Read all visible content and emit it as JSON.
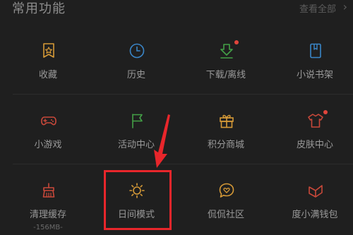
{
  "header": {
    "title": "常用功能",
    "view_all": "查看全部"
  },
  "rows": [
    [
      {
        "label": "收藏",
        "icon": "bookmark-star-icon",
        "color": "#d69a37"
      },
      {
        "label": "历史",
        "icon": "clock-icon",
        "color": "#3a86c8"
      },
      {
        "label": "下载/离线",
        "icon": "download-icon",
        "color": "#43a047",
        "badge": true
      },
      {
        "label": "小说书架",
        "icon": "bookshelf-icon",
        "color": "#3a86c8"
      }
    ],
    [
      {
        "label": "小游戏",
        "icon": "gamepad-icon",
        "color": "#c8483a"
      },
      {
        "label": "活动中心",
        "icon": "flag-icon",
        "color": "#43a047"
      },
      {
        "label": "积分商城",
        "icon": "gift-icon",
        "color": "#d69a37"
      },
      {
        "label": "皮肤中心",
        "icon": "shirt-icon",
        "color": "#c8483a",
        "badge": true
      }
    ],
    [
      {
        "label": "清理缓存",
        "icon": "broom-icon",
        "color": "#c8483a",
        "sub": "-156MB-"
      },
      {
        "label": "日间模式",
        "icon": "sun-icon",
        "color": "#d69a37"
      },
      {
        "label": "侃侃社区",
        "icon": "chat-heart-icon",
        "color": "#d69a37"
      },
      {
        "label": "度小满钱包",
        "icon": "wallet-icon",
        "color": "#c8483a"
      }
    ]
  ],
  "colors": {
    "highlight": "#e8262b",
    "badge": "#e2453c"
  }
}
